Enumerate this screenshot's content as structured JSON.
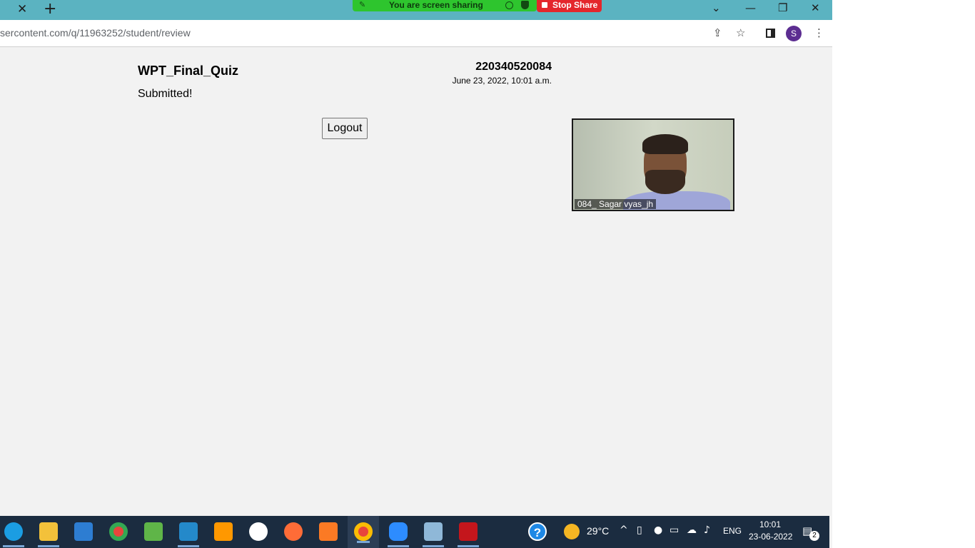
{
  "browser": {
    "url": "sercontent.com/q/11963252/student/review",
    "tab_close": "✕",
    "tab_new": "+",
    "profile_initial": "S"
  },
  "zoom_banner": {
    "sharing_text": "You are screen sharing",
    "stop_label": "Stop Share"
  },
  "page": {
    "quiz_title": "WPT_Final_Quiz",
    "status": "Submitted!",
    "student_id": "220340520084",
    "date": "June 23, 2022, 10:01 a.m.",
    "logout_label": "Logout"
  },
  "video": {
    "participant_name": "084_ Sagar vyas_jh"
  },
  "taskbar": {
    "apps": [
      "edge",
      "file-explorer",
      "microsoft-store",
      "chrome",
      "snipping-tool",
      "vs-code",
      "sublime-text",
      "mongodb-compass",
      "postman",
      "xampp",
      "chrome-profile",
      "zoom",
      "notepad",
      "acrobat-reader"
    ],
    "help_icon": "?",
    "temperature": "29°C",
    "language": "ENG",
    "time": "10:01",
    "date": "23-06-2022",
    "notification_count": "2"
  },
  "colors": {
    "tabstrip": "#5bb3c1",
    "share_banner": "#2ec52e",
    "stop_share": "#e4262c",
    "taskbar": "#1b2c40",
    "page_background": "#f2f2f2"
  }
}
